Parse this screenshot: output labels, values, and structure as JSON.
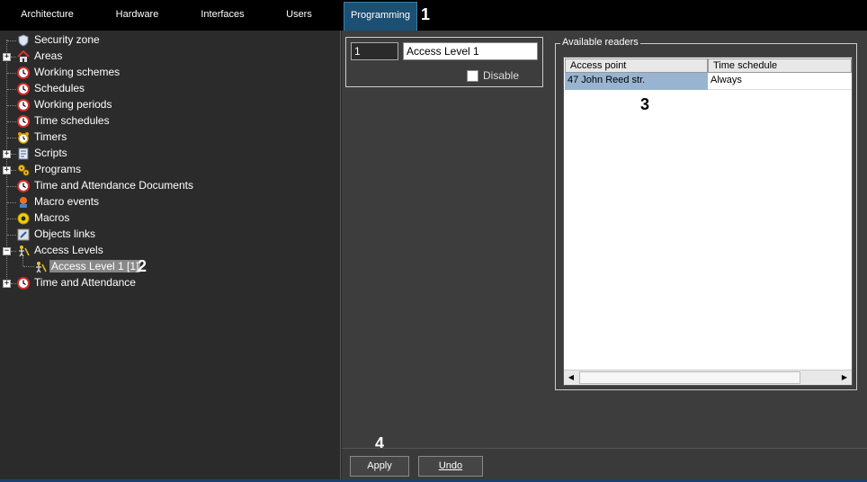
{
  "tabs": [
    {
      "label": "Architecture"
    },
    {
      "label": "Hardware"
    },
    {
      "label": "Interfaces"
    },
    {
      "label": "Users"
    },
    {
      "label": "Programming",
      "active": true
    }
  ],
  "markers": {
    "m1": "1",
    "m2": "2",
    "m3": "3",
    "m4": "4"
  },
  "tree": {
    "items": [
      {
        "label": "Security zone",
        "icon": "shield-icon",
        "expandable": false
      },
      {
        "label": "Areas",
        "icon": "house-icon",
        "expandable": true
      },
      {
        "label": "Working schemes",
        "icon": "clock-icon",
        "expandable": false
      },
      {
        "label": "Schedules",
        "icon": "clock-icon",
        "expandable": false
      },
      {
        "label": "Working periods",
        "icon": "clock-icon",
        "expandable": false
      },
      {
        "label": "Time schedules",
        "icon": "clock-icon",
        "expandable": false
      },
      {
        "label": "Timers",
        "icon": "alarm-clock-icon",
        "expandable": false
      },
      {
        "label": "Scripts",
        "icon": "script-icon",
        "expandable": true
      },
      {
        "label": "Programs",
        "icon": "gears-icon",
        "expandable": true
      },
      {
        "label": "Time and Attendance Documents",
        "icon": "clock-icon",
        "expandable": false
      },
      {
        "label": "Macro events",
        "icon": "macro-event-icon",
        "expandable": false
      },
      {
        "label": "Macros",
        "icon": "macro-icon",
        "expandable": false
      },
      {
        "label": "Objects links",
        "icon": "link-icon",
        "expandable": false
      },
      {
        "label": "Access Levels",
        "icon": "access-level-icon",
        "expandable": true,
        "expanded": true
      },
      {
        "label": "Access Level 1 [1]",
        "icon": "access-level-icon",
        "child": true,
        "selected": true
      },
      {
        "label": "Time and Attendance",
        "icon": "clock-icon",
        "expandable": true
      }
    ]
  },
  "form": {
    "id_value": "1",
    "name_value": "Access Level 1",
    "disable_label": "Disable",
    "disable_checked": false
  },
  "readers": {
    "group_title": "Available readers",
    "columns": [
      "Access point",
      "Time schedule"
    ],
    "rows": [
      {
        "access_point": "47 John Reed str.",
        "time_schedule": "Always"
      }
    ]
  },
  "buttons": {
    "apply": "Apply",
    "undo": "Undo"
  },
  "colors": {
    "active_tab": "#1b4f73",
    "selection": "#99b4d1",
    "clock_red": "#d42b2b"
  }
}
